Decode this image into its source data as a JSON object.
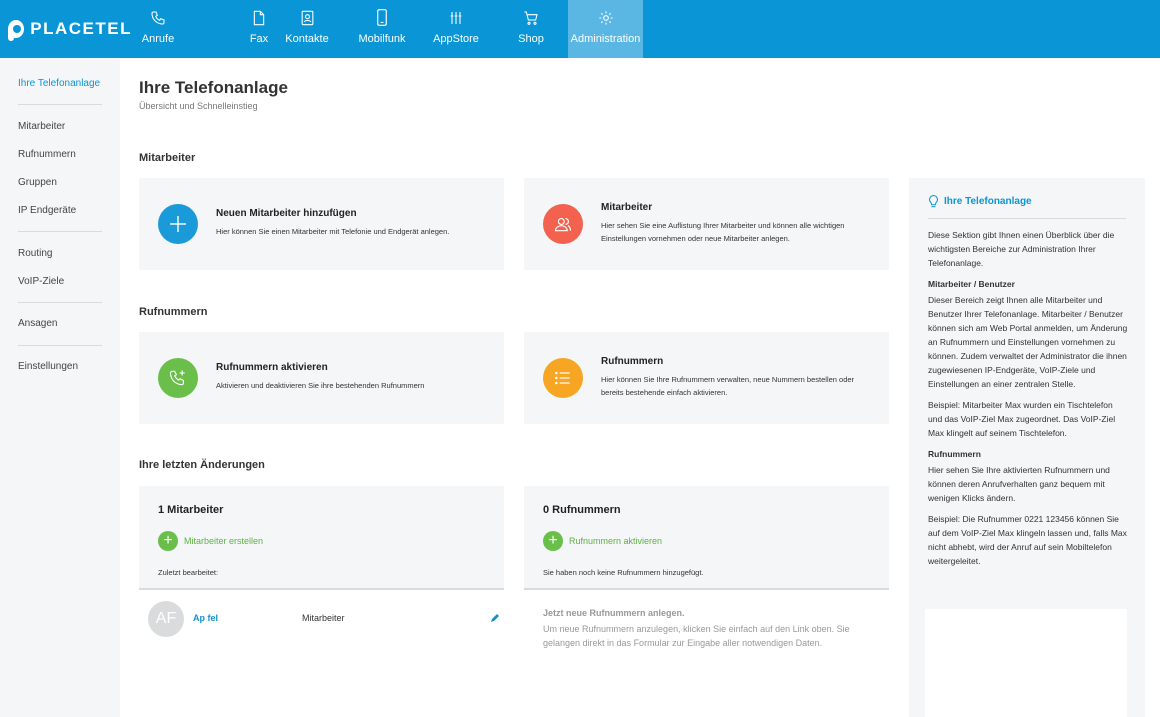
{
  "brand": {
    "name": "PLACETEL"
  },
  "nav": {
    "items": [
      {
        "label": "Anrufe",
        "icon": "phone-icon"
      },
      {
        "label": "Fax",
        "icon": "fax-icon"
      },
      {
        "label": "Kontakte",
        "icon": "contacts-icon"
      },
      {
        "label": "Mobilfunk",
        "icon": "mobile-icon"
      },
      {
        "label": "AppStore",
        "icon": "appstore-icon"
      },
      {
        "label": "Shop",
        "icon": "cart-icon"
      },
      {
        "label": "Administration",
        "icon": "gear-icon"
      }
    ],
    "active": "Administration"
  },
  "sidebar": {
    "items": [
      {
        "label": "Ihre Telefonanlage"
      },
      {
        "label": "Mitarbeiter"
      },
      {
        "label": "Rufnummern"
      },
      {
        "label": "Gruppen"
      },
      {
        "label": "IP Endgeräte"
      },
      {
        "label": "Routing"
      },
      {
        "label": "VoIP-Ziele"
      },
      {
        "label": "Ansagen"
      },
      {
        "label": "Einstellungen"
      }
    ]
  },
  "page": {
    "title": "Ihre Telefonanlage",
    "subtitle": "Übersicht und Schnelleinstieg"
  },
  "sections": {
    "mitarbeiter": "Mitarbeiter",
    "rufnummern": "Rufnummern",
    "recent": "Ihre letzten Änderungen"
  },
  "cards": {
    "add_employee": {
      "title": "Neuen Mitarbeiter hinzufügen",
      "desc": "Hier können Sie einen Mitarbeiter mit Telefonie und Endgerät anlegen.",
      "color": "#1a9ad9"
    },
    "employees": {
      "title": "Mitarbeiter",
      "desc": "Hier sehen Sie eine Auflistung Ihrer Mitarbeiter und können alle wichtigen Einstellungen vornehmen oder neue Mitarbeiter anlegen.",
      "color": "#f2624e"
    },
    "activate_numbers": {
      "title": "Rufnummern aktivieren",
      "desc": "Aktivieren und deaktivieren Sie ihre bestehenden Rufnummern",
      "color": "#6abf4b"
    },
    "numbers": {
      "title": "Rufnummern",
      "desc": "Hier können Sie Ihre Rufnummern verwalten, neue Nummern bestellen oder bereits bestehende einfach aktivieren.",
      "color": "#f6a623"
    }
  },
  "recent": {
    "employees": {
      "title": "1 Mitarbeiter",
      "action": "Mitarbeiter erstellen",
      "note": "Zuletzt bearbeitet:",
      "row": {
        "avatar": "AF",
        "name": "Ap fel",
        "role": "Mitarbeiter"
      }
    },
    "numbers": {
      "title": "0 Rufnummern",
      "action": "Rufnummern aktivieren",
      "note": "Sie haben noch keine Rufnummern hinzugefügt.",
      "empty_title": "Jetzt neue Rufnummern anlegen.",
      "empty_text": "Um neue Rufnummern anzulegen, klicken Sie einfach auf den Link oben. Sie gelangen direkt in das Formular zur Eingabe aller notwendigen Daten."
    }
  },
  "info": {
    "title": "Ihre Telefonanlage",
    "intro": "Diese Sektion gibt Ihnen einen Überblick über die wichtigsten Bereiche zur Administration Ihrer Telefonanlage.",
    "h1": "Mitarbeiter / Benutzer",
    "p1": "Dieser Bereich zeigt Ihnen alle Mitarbeiter und Benutzer Ihrer Telefonanlage. Mitarbeiter / Benutzer können sich am Web Portal anmelden, um Änderung an Rufnummern und Einstellungen vornehmen zu können. Zudem verwaltet der Administrator die ihnen zugewiesenen IP-Endgeräte, VoIP-Ziele und Einstellungen an einer zentralen Stelle.",
    "ex1": "Beispiel: Mitarbeiter Max wurden ein Tischtelefon und das VoIP-Ziel Max zugeordnet. Das VoIP-Ziel Max klingelt auf seinem Tischtelefon.",
    "h2": "Rufnummern",
    "p2": "Hier sehen Sie Ihre aktivierten Rufnummern und können deren Anrufverhalten ganz bequem mit wenigen Klicks ändern.",
    "ex2": "Beispiel: Die Rufnummer 0221 123456 können Sie auf dem VoIP-Ziel Max klingeln lassen und, falls Max nicht abhebt, wird der Anruf auf sein Mobiltelefon weitergeleitet."
  },
  "colors": {
    "brand": "#0a95d6",
    "nav_active": "#5ab7e3",
    "card_bg": "#f5f6f7",
    "green": "#6abf4b"
  }
}
